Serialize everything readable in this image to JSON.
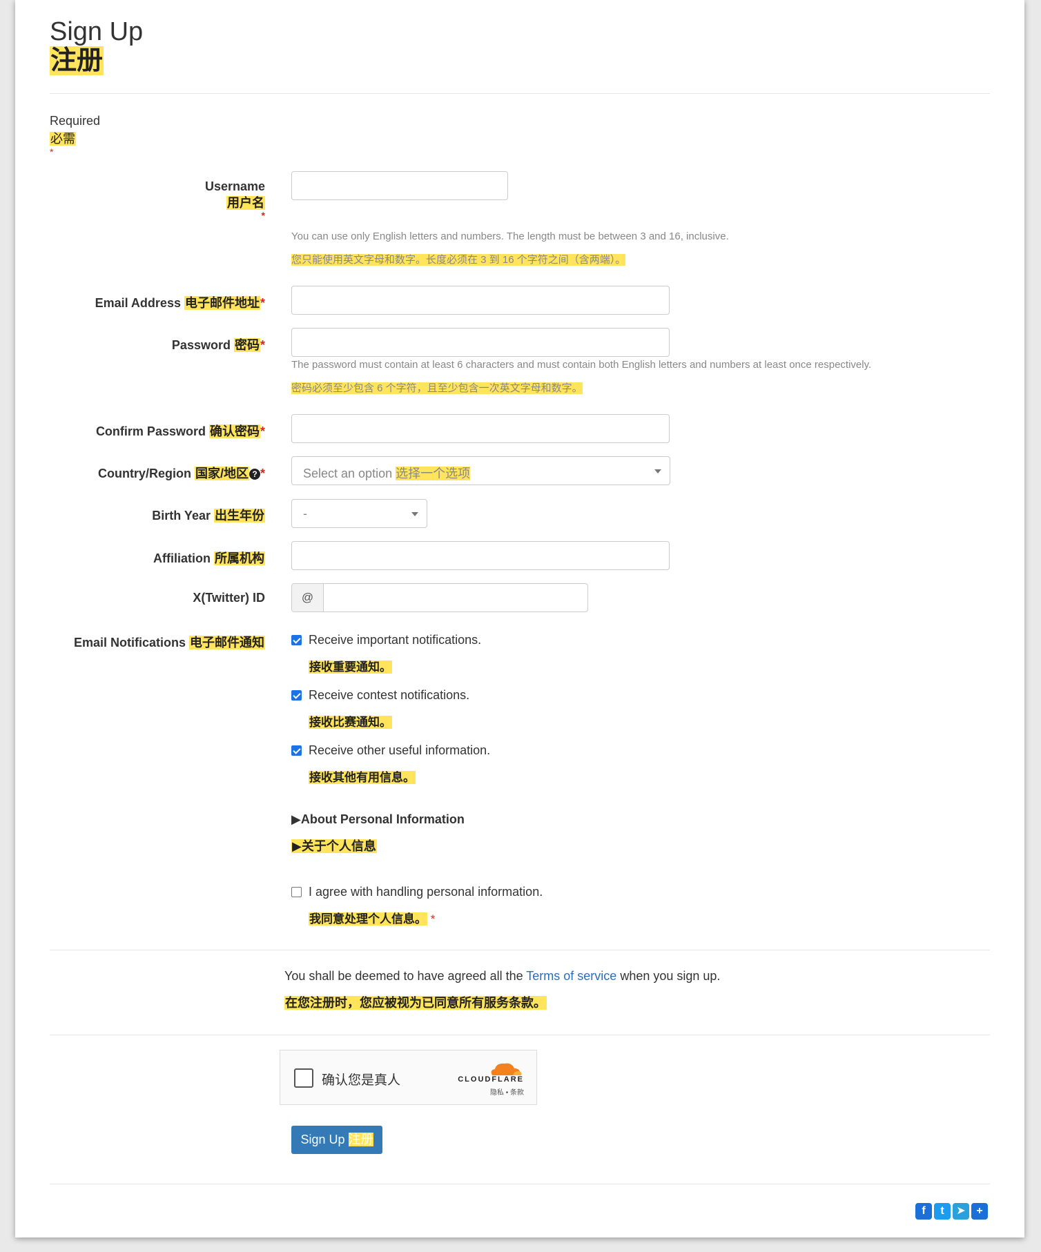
{
  "header": {
    "title_en": "Sign Up",
    "title_cn": "注册"
  },
  "required_legend": {
    "en": "Required",
    "cn": "必需",
    "mark": "*"
  },
  "fields": {
    "username": {
      "label_en": "Username",
      "label_cn": "用户名",
      "required": "*",
      "help_en": "You can use only English letters and numbers. The length must be between 3 and 16, inclusive.",
      "help_cn": "您只能使用英文字母和数字。长度必须在 3 到 16 个字符之间（含两端）。",
      "value": ""
    },
    "email": {
      "label_en": "Email Address",
      "label_cn": "电子邮件地址",
      "required": "*",
      "value": ""
    },
    "password": {
      "label_en": "Password",
      "label_cn": "密码",
      "required": "*",
      "help_en": "The password must contain at least 6 characters and must contain both English letters and numbers at least once respectively.",
      "help_cn": "密码必须至少包含 6 个字符，且至少包含一次英文字母和数字。",
      "value": ""
    },
    "confirm_password": {
      "label_en": "Confirm Password",
      "label_cn": "确认密码",
      "required": "*",
      "value": ""
    },
    "country": {
      "label_en": "Country/Region",
      "label_cn": "国家/地区",
      "required": "*",
      "help_icon": "question-circle-icon",
      "placeholder_en": "Select an option",
      "placeholder_cn": "选择一个选项"
    },
    "birth_year": {
      "label_en": "Birth Year",
      "label_cn": "出生年份",
      "value": "-"
    },
    "affiliation": {
      "label_en": "Affiliation",
      "label_cn": "所属机构",
      "value": ""
    },
    "twitter": {
      "label_en": "X(Twitter) ID",
      "addon": "@",
      "value": ""
    }
  },
  "notifications": {
    "label_en": "Email Notifications",
    "label_cn": "电子邮件通知",
    "items": [
      {
        "en": "Receive important notifications.",
        "cn": "接收重要通知。",
        "checked": true
      },
      {
        "en": "Receive contest notifications.",
        "cn": "接收比赛通知。",
        "checked": true
      },
      {
        "en": "Receive other useful information.",
        "cn": "接收其他有用信息。",
        "checked": true
      }
    ]
  },
  "personal_info": {
    "en": "▶About Personal Information",
    "cn": "▶关于个人信息"
  },
  "agree": {
    "en": "I agree with handling personal information.",
    "cn": "我同意处理个人信息。",
    "required": "*",
    "checked": false
  },
  "terms": {
    "prefix": "You shall be deemed to have agreed all the ",
    "link": "Terms of service",
    "suffix": " when you sign up.",
    "cn": "在您注册时，您应被视为已同意所有服务条款。"
  },
  "captcha": {
    "text": "确认您是真人",
    "brand": "CLOUDFLARE",
    "links": "隐私 • 条款"
  },
  "submit": {
    "en": "Sign Up",
    "cn": "注册"
  },
  "share": [
    {
      "name": "facebook-icon",
      "glyph": "f"
    },
    {
      "name": "twitter-icon",
      "glyph": "t"
    },
    {
      "name": "telegram-icon",
      "glyph": "➤"
    },
    {
      "name": "share-plus-icon",
      "glyph": "+"
    }
  ],
  "colors": {
    "highlight": "#ffe45c",
    "primary": "#337ab7",
    "link": "#2a6ebb",
    "required": "#d9261c",
    "checkbox": "#1a73e8"
  }
}
